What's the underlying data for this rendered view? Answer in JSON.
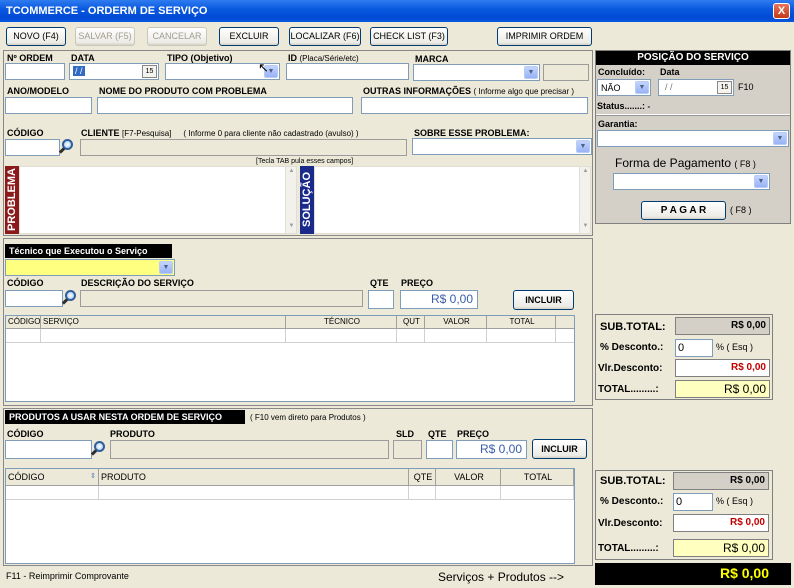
{
  "window": {
    "title": "TCOMMERCE - ORDERM DE SERVIÇO",
    "close": "X"
  },
  "toolbar": {
    "novo": "NOVO (F4)",
    "salvar": "SALVAR (F5)",
    "cancelar": "CANCELAR",
    "excluir": "EXCLUIR",
    "localizar": "LOCALIZAR (F6)",
    "checklist": "CHECK LIST (F3)",
    "imprimir": "IMPRIMIR ORDEM"
  },
  "form": {
    "n_ordem": "Nº ORDEM",
    "data": "DATA",
    "data_value": "/ /",
    "tipo": "TIPO (Objetivo)",
    "id_label": "ID",
    "id_hint": "(Placa/Série/etc)",
    "marca": "MARCA",
    "ano_modelo": "ANO/MODELO",
    "nome_produto": "NOME DO PRODUTO COM PROBLEMA",
    "outras_info": "OUTRAS INFORMAÇÕES",
    "outras_hint": "( Informe algo que precisar )",
    "codigo": "CÓDIGO",
    "cliente": "CLIENTE",
    "cliente_hint": "[F7-Pesquisa]",
    "cliente_note": "( Informe 0 para cliente não cadastrado (avulso) )",
    "sobre": "SOBRE ESSE PROBLEMA:",
    "tab_note": "[Tecla TAB pula esses campos]",
    "problema": "PROBLEMA",
    "solucao": "SOLUÇÃO"
  },
  "servico": {
    "tecnico_header": "Técnico que Executou o Serviço",
    "codigo": "CÓDIGO",
    "descricao": "DESCRIÇÃO DO SERVIÇO",
    "qte": "QTE",
    "preco": "PREÇO",
    "preco_value": "R$ 0,00",
    "incluir": "INCLUIR",
    "columns": [
      "CÓDIGO",
      "SERVIÇO",
      "TÉCNICO",
      "QUT",
      "VALOR",
      "TOTAL"
    ]
  },
  "produtos": {
    "header": "PRODUTOS A USAR NESTA ORDEM DE SERVIÇO",
    "header_hint": "( F10 vem direto para Produtos )",
    "codigo": "CÓDIGO",
    "produto": "PRODUTO",
    "sld": "SLD",
    "qte": "QTE",
    "preco": "PREÇO",
    "preco_value": "R$ 0,00",
    "incluir": "INCLUIR",
    "columns": [
      "CÓDIGO",
      "PRODUTO",
      "QTE",
      "VALOR",
      "TOTAL"
    ]
  },
  "posicao": {
    "title": "POSIÇÃO DO SERVIÇO",
    "concluido": "Concluído:",
    "data": "Data",
    "concluido_value": "NÃO",
    "data_value": "/ /",
    "f10": "F10",
    "status": "Status.......:",
    "status_value": "-",
    "garantia": "Garantia:",
    "forma_pagamento": "Forma de Pagamento",
    "forma_hint": "( F8 )",
    "pagar": "P A G A R",
    "pagar_hint": "( F8 )"
  },
  "totais_servico": {
    "subtotal": "SUB.TOTAL:",
    "subtotal_value": "R$ 0,00",
    "desconto": "% Desconto.:",
    "desconto_value": "0",
    "esq": "% ( Esq )",
    "vlr_desconto": "Vlr.Desconto:",
    "vlr_desconto_value": "R$ 0,00",
    "total": "TOTAL.........:",
    "total_value": "R$ 0,00"
  },
  "totais_produto": {
    "subtotal": "SUB.TOTAL:",
    "subtotal_value": "R$ 0,00",
    "desconto": "% Desconto.:",
    "desconto_value": "0",
    "esq": "% ( Esq )",
    "vlr_desconto": "Vlr.Desconto:",
    "vlr_desconto_value": "R$ 0,00",
    "total": "TOTAL.........:",
    "total_value": "R$ 0,00"
  },
  "footer": {
    "reimprimir": "F11 - Reimprimir Comprovante",
    "servicos_produtos": "Serviços + Produtos -->",
    "grand_total": "R$ 0,00"
  },
  "colors": {
    "titlebar": "#0A5ADF",
    "yellow_total": "#FFFFC0",
    "red_value": "#C00000",
    "grand_total_bg": "#000000",
    "grand_total_fg": "#FFFF00"
  }
}
